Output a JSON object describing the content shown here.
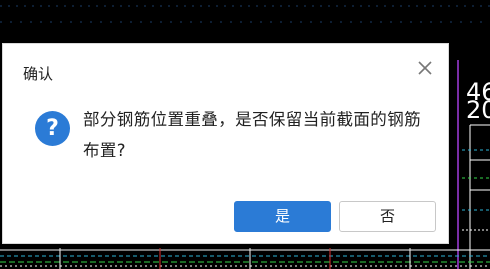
{
  "dialog": {
    "title": "确认",
    "message": "部分钢筋位置重叠，是否保留当前截面的钢筋布置?",
    "yes_label": "是",
    "no_label": "否",
    "icon": "question-icon",
    "close_icon": "close-icon"
  },
  "background": {
    "partial_text_1": "46",
    "partial_text_2": "20"
  },
  "colors": {
    "accent": "#2b7bd6",
    "background": "#000000",
    "dialog_bg": "#ffffff"
  }
}
